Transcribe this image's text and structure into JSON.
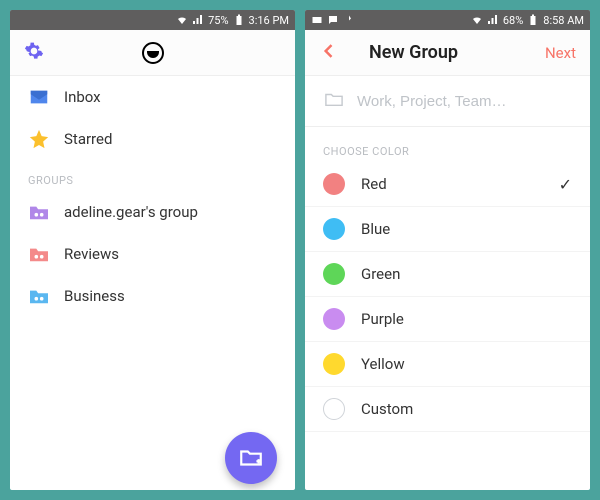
{
  "left": {
    "statusbar": {
      "battery": "75%",
      "time": "3:16 PM"
    },
    "nav": {
      "inbox": "Inbox",
      "starred": "Starred"
    },
    "groups_label": "GROUPS",
    "groups": [
      {
        "label": "adeline.gear's group",
        "color": "#b087e8"
      },
      {
        "label": "Reviews",
        "color": "#f48a8a"
      },
      {
        "label": "Business",
        "color": "#5ab7f0"
      }
    ]
  },
  "right": {
    "statusbar": {
      "battery": "68%",
      "time": "8:58 AM"
    },
    "title": "New Group",
    "next": "Next",
    "placeholder": "Work, Project, Team…",
    "choose_label": "CHOOSE COLOR",
    "colors": [
      {
        "label": "Red",
        "hex": "#f28181",
        "selected": true
      },
      {
        "label": "Blue",
        "hex": "#3fbdf4",
        "selected": false
      },
      {
        "label": "Green",
        "hex": "#5ed658",
        "selected": false
      },
      {
        "label": "Purple",
        "hex": "#c98cf0",
        "selected": false
      },
      {
        "label": "Yellow",
        "hex": "#ffd92e",
        "selected": false
      },
      {
        "label": "Custom",
        "hex": "",
        "selected": false
      }
    ]
  }
}
